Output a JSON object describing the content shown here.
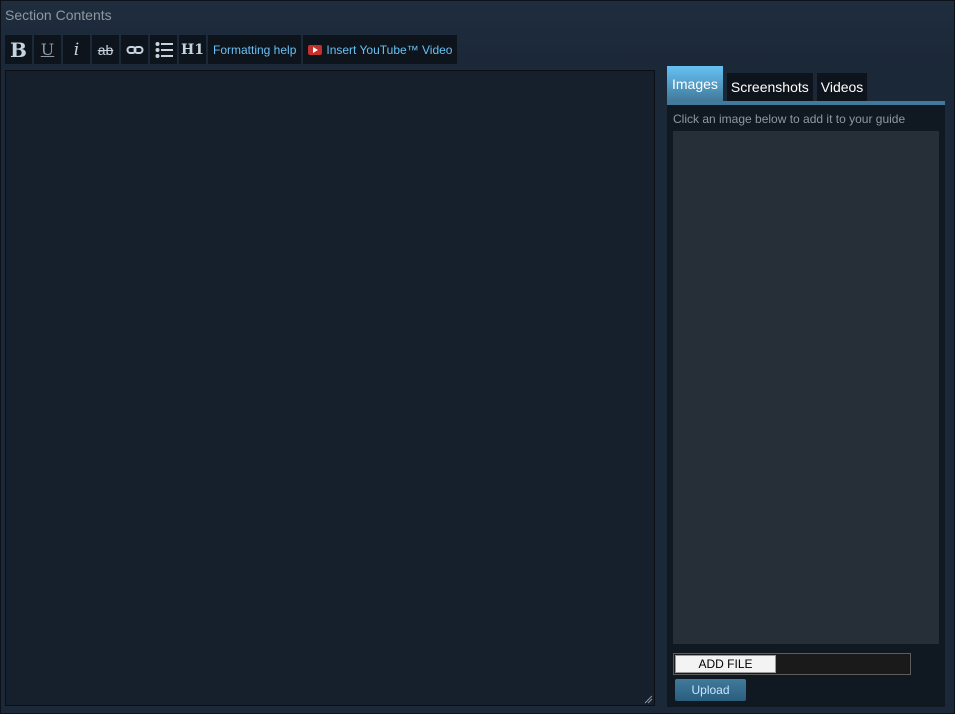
{
  "section": {
    "title": "Section Contents"
  },
  "toolbar": {
    "bold_label": "B",
    "underline_label": "U",
    "italic_label": "i",
    "strike_label": "ab",
    "heading_label": "H1",
    "formatting_help": "Formatting help",
    "youtube_label": "Insert YouTube™ Video"
  },
  "editor": {
    "value": ""
  },
  "panel": {
    "tabs": [
      {
        "label": "Images",
        "active": true
      },
      {
        "label": "Screenshots",
        "active": false
      },
      {
        "label": "Videos",
        "active": false
      }
    ],
    "hint": "Click an image below to add it to your guide",
    "add_file_label": "ADD FILE",
    "upload_label": "Upload"
  },
  "colors": {
    "background": "#1b2838",
    "accent": "#67c1f5",
    "tab_active": "#417a9b"
  }
}
